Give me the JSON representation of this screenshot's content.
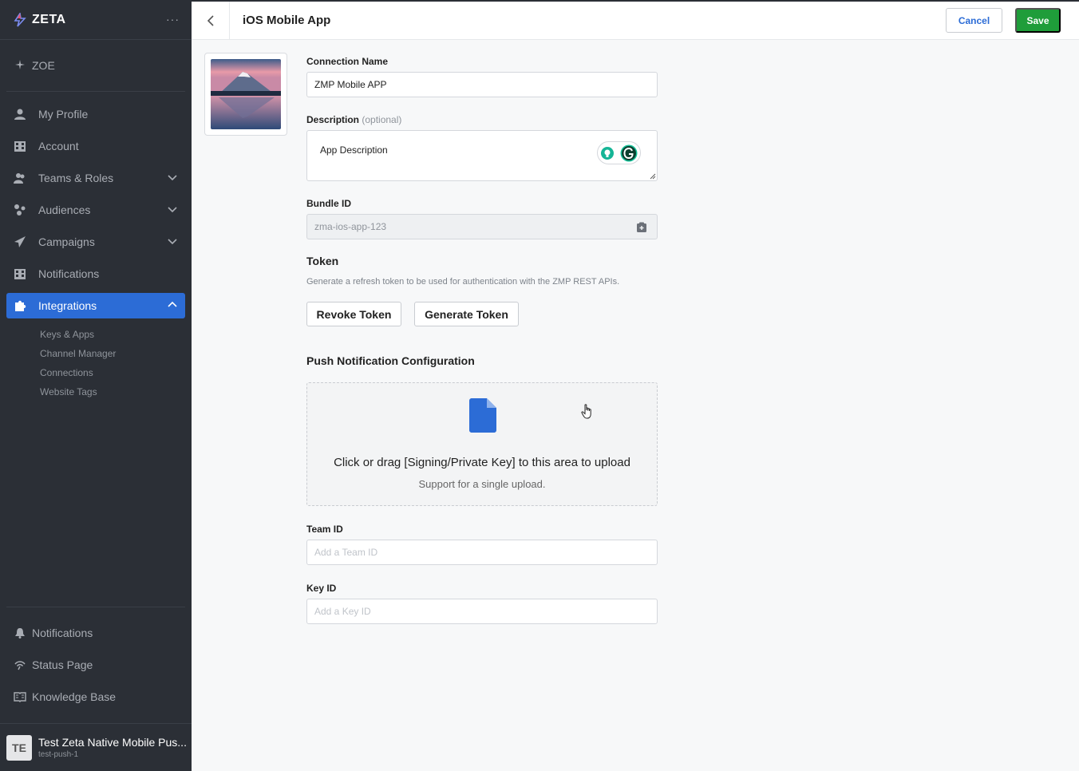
{
  "sidebar": {
    "brand": "ZETA",
    "menu_dots": "···",
    "zoe": "ZOE",
    "items": [
      {
        "label": "My Profile",
        "icon": "user-icon"
      },
      {
        "label": "Account",
        "icon": "building-icon"
      },
      {
        "label": "Teams & Roles",
        "icon": "users-icon",
        "expandable": true
      },
      {
        "label": "Audiences",
        "icon": "audience-icon",
        "expandable": true
      },
      {
        "label": "Campaigns",
        "icon": "paper-plane-icon",
        "expandable": true
      },
      {
        "label": "Notifications",
        "icon": "building-icon"
      },
      {
        "label": "Integrations",
        "icon": "puzzle-icon",
        "expandable": true,
        "active": true
      }
    ],
    "sub_items": [
      "Keys & Apps",
      "Channel Manager",
      "Connections",
      "Website Tags"
    ],
    "bottom_items": [
      {
        "label": "Notifications",
        "icon": "bell-icon"
      },
      {
        "label": "Status Page",
        "icon": "signal-icon"
      },
      {
        "label": "Knowledge Base",
        "icon": "book-icon"
      }
    ],
    "user": {
      "initials": "TE",
      "name": "Test Zeta Native Mobile Pus...",
      "sub": "test-push-1"
    }
  },
  "header": {
    "title": "iOS Mobile App",
    "cancel_label": "Cancel",
    "save_label": "Save"
  },
  "form": {
    "connection_name": {
      "label": "Connection Name",
      "value": "ZMP Mobile APP"
    },
    "description": {
      "label": "Description",
      "optional": "(optional)",
      "value": "App Description"
    },
    "bundle_id": {
      "label": "Bundle ID",
      "value": "zma-ios-app-123"
    },
    "token": {
      "title": "Token",
      "helper": "Generate a refresh token to be used for authentication with the ZMP REST APIs.",
      "revoke_label": "Revoke Token",
      "generate_label": "Generate Token"
    },
    "push": {
      "title": "Push Notification Configuration",
      "upload_text": "Click or drag [Signing/Private Key] to this area to upload",
      "upload_sub": "Support for a single upload."
    },
    "team_id": {
      "label": "Team ID",
      "placeholder": "Add a Team ID"
    },
    "key_id": {
      "label": "Key ID",
      "placeholder": "Add a Key ID"
    }
  },
  "colors": {
    "sidebar_bg": "#2b2f36",
    "active_blue": "#2c6cd6",
    "save_green": "#1f9d3a",
    "file_icon_blue": "#2c6cd6"
  }
}
